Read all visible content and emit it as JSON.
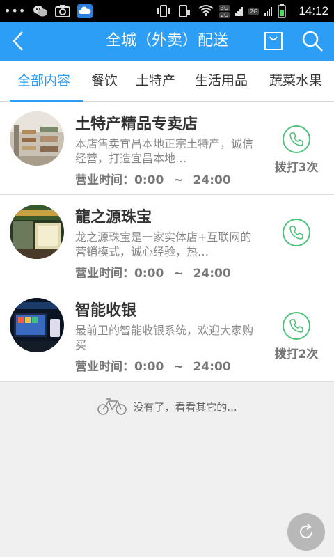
{
  "status_bar": {
    "dots": "•••",
    "net_badge_top": "3G",
    "net_badge_bottom": "2G",
    "net_badge_2g": "2G",
    "time": "14:12"
  },
  "header": {
    "title": "全城（外卖）配送"
  },
  "tabs": [
    {
      "label": "全部内容",
      "active": true
    },
    {
      "label": "餐饮",
      "active": false
    },
    {
      "label": "土特产",
      "active": false
    },
    {
      "label": "生活用品",
      "active": false
    },
    {
      "label": "蔬菜水果",
      "active": false
    }
  ],
  "stores": [
    {
      "name": "土特产精品专卖店",
      "description": "本店售卖宜昌本地正宗土特产，诚信经营，打造宜昌本地…",
      "hours_label": "营业时间：",
      "open": "0:00",
      "separator": "~",
      "close": "24:00",
      "calls": "拨打3次"
    },
    {
      "name": "龍之源珠宝",
      "description": "龙之源珠宝是一家实体店+互联网的营销模式，诚心经验，热…",
      "hours_label": "营业时间：",
      "open": "0:00",
      "separator": "~",
      "close": "24:00",
      "calls": ""
    },
    {
      "name": "智能收银",
      "description": "最前卫的智能收银系统，欢迎大家购买",
      "hours_label": "营业时间：",
      "open": "0:00",
      "separator": "~",
      "close": "24:00",
      "calls": "拨打2次"
    }
  ],
  "end_message": "没有了，看看其它的...",
  "colors": {
    "primary": "#2d9ef5",
    "phone_green": "#4cc37a",
    "background": "#f0f0f0"
  }
}
